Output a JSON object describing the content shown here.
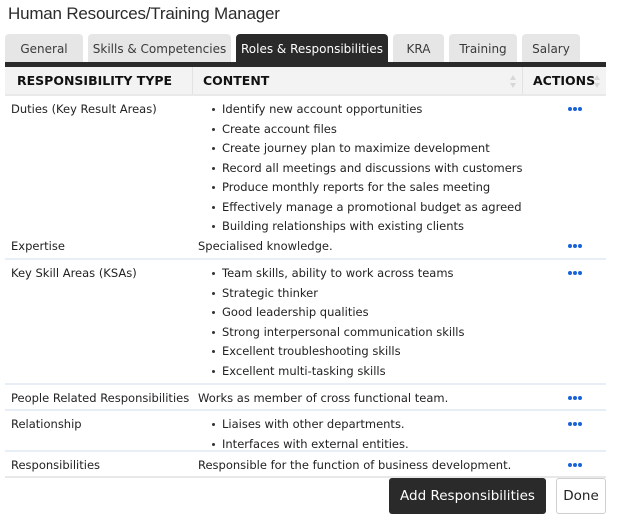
{
  "window": {
    "title": "Human Resources/Training Manager"
  },
  "tabs": [
    {
      "label": "General",
      "active": false
    },
    {
      "label": "Skills & Competencies",
      "active": false
    },
    {
      "label": "Roles & Responsibilities",
      "active": true
    },
    {
      "label": "KRA",
      "active": false
    },
    {
      "label": "Training",
      "active": false
    },
    {
      "label": "Salary",
      "active": false
    }
  ],
  "table": {
    "headers": {
      "type": "RESPONSIBILITY TYPE",
      "content": "CONTENT",
      "actions": "ACTIONS"
    },
    "rows": [
      {
        "type": "Duties (Key Result Areas)",
        "items": [
          "Identify new account opportunities",
          "Create account files",
          "Create journey plan to maximize development",
          "Record all meetings and discussions with customers",
          "Produce monthly reports for the sales meeting",
          "Effectively manage a promotional budget as agreed",
          "Building relationships with existing clients"
        ],
        "action_icon": "more-horizontal-icon"
      },
      {
        "type": "Expertise",
        "text": "Specialised knowledge.",
        "action_icon": "more-horizontal-icon"
      },
      {
        "type": "Key Skill Areas (KSAs)",
        "items": [
          "Team skills, ability to work across teams",
          "Strategic thinker",
          "Good leadership qualities",
          "Strong interpersonal communication skills",
          "Excellent troubleshooting skills",
          "Excellent multi-tasking skills"
        ],
        "action_icon": "more-horizontal-icon"
      },
      {
        "type": "People Related Responsibilities",
        "text": "Works as member of cross functional team.",
        "action_icon": "more-horizontal-icon"
      },
      {
        "type": "Relationship",
        "items": [
          "Liaises with other departments.",
          "Interfaces with external entities."
        ],
        "action_icon": "more-horizontal-icon"
      },
      {
        "type": "Responsibilities",
        "text": "Responsible for the function of business development.",
        "action_icon": "more-horizontal-icon"
      }
    ]
  },
  "buttons": {
    "add_label": "Add Responsibilities",
    "done_label": "Done"
  },
  "colors": {
    "dark": "#2a2a2a",
    "action_dots": "#1a63d6",
    "tab_inactive": "#e6e6e6"
  }
}
